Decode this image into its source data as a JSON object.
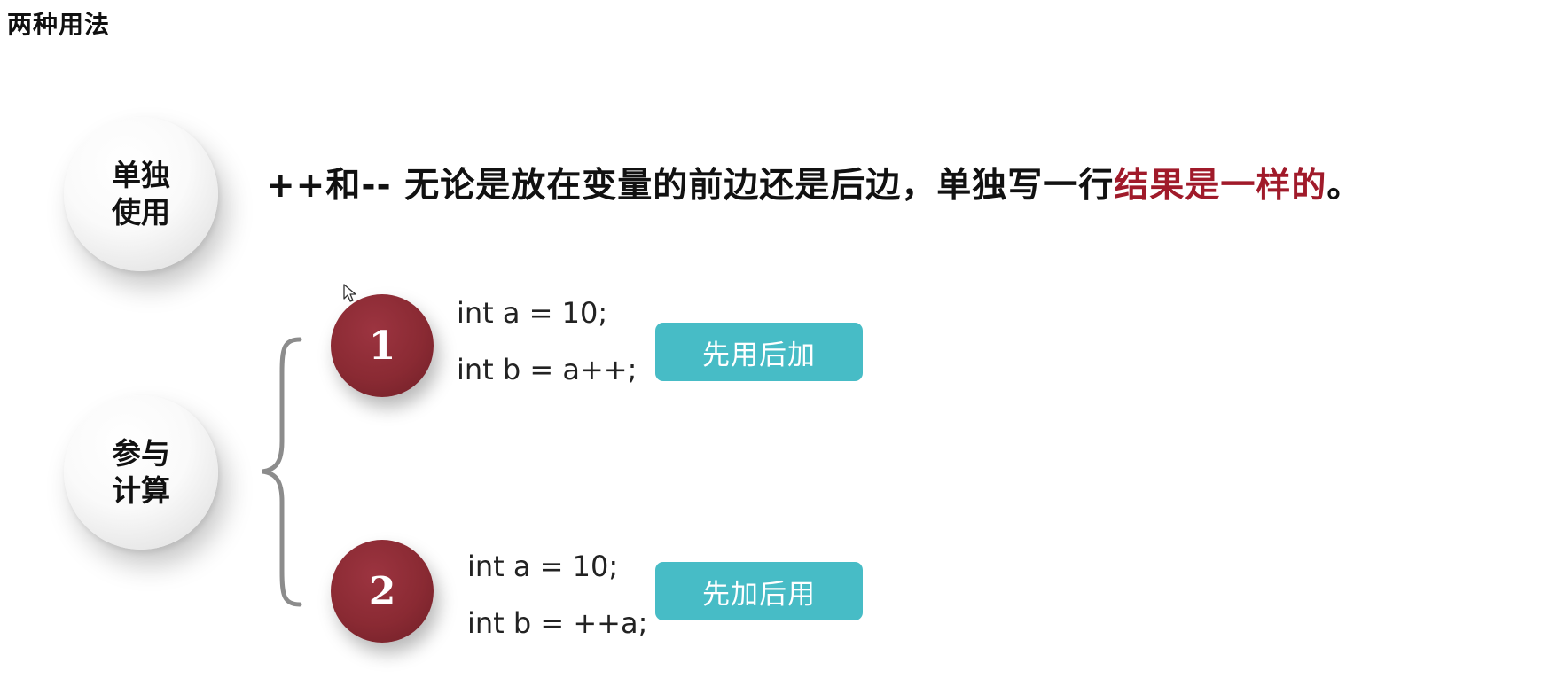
{
  "title": "两种用法",
  "standalone": {
    "label": "单独使用",
    "statement_prefix": "++和-- 无论是放在变量的前边还是后边，单独写一行",
    "statement_highlight": "结果是一样的",
    "statement_suffix": "。",
    "highlight_color": "#a01a2a"
  },
  "in_expression": {
    "label": "参与计算",
    "cases": [
      {
        "number": "1",
        "code": [
          "int a = 10;",
          "int b = a++;"
        ],
        "tag": "先用后加"
      },
      {
        "number": "2",
        "code": [
          "int a = 10;",
          "int b = ++a;"
        ],
        "tag": "先加后用"
      }
    ]
  },
  "colors": {
    "badge": "#8a2a33",
    "tag": "#47bcc6",
    "brace": "#8c8c8c"
  },
  "icons": {
    "cursor": "mouse-pointer-icon"
  }
}
